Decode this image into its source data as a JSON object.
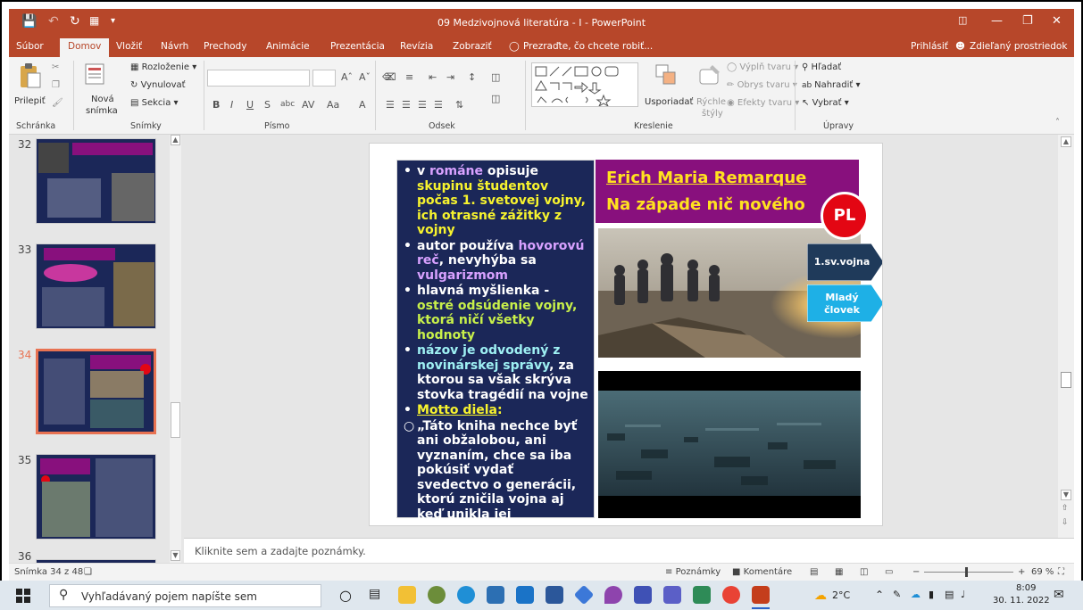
{
  "window": {
    "title": "09 Medzivojnová literatúra - I - PowerPoint",
    "signin": "Prihlásiť",
    "share": "Zdieľaný prostriedok"
  },
  "tabs": [
    "Súbor",
    "Domov",
    "Vložiť",
    "Návrh",
    "Prechody",
    "Animácie",
    "Prezentácia",
    "Revízia",
    "Zobraziť"
  ],
  "active_tab": "Domov",
  "tell_me": "Prezraďte, čo chcete robiť...",
  "ribbon": {
    "paste": "Prilepiť",
    "new_slide_1": "Nová",
    "new_slide_2": "snímka",
    "layout": "Rozloženie",
    "reset": "Vynulovať",
    "section": "Sekcia",
    "arrange": "Usporiadať",
    "quick_styles_1": "Rýchle",
    "quick_styles_2": "štýly",
    "shape_fill": "Výplň tvaru",
    "shape_outline": "Obrys tvaru",
    "shape_effects": "Efekty tvaru",
    "find": "Hľadať",
    "replace": "Nahradiť",
    "select": "Vybrať",
    "group_clipboard": "Schránka",
    "group_slides": "Snímky",
    "group_font": "Písmo",
    "group_paragraph": "Odsek",
    "group_drawing": "Kreslenie",
    "group_editing": "Úpravy"
  },
  "slides_pane": {
    "numbers": [
      "32",
      "33",
      "34",
      "35",
      "36"
    ],
    "selected": "34"
  },
  "slide": {
    "title_line1": "Erich Maria Remarque",
    "title_line2": "Na západe nič nového",
    "badge": "PL",
    "tag1": "1.sv.vojna",
    "tag2_line1": "Mladý",
    "tag2_line2": "človek",
    "bullets": [
      {
        "id": "b1",
        "bullet": "•",
        "segments": [
          {
            "t": "v ",
            "c": "w"
          },
          {
            "t": "románe",
            "c": "p"
          },
          {
            "t": " opisuje ",
            "c": "w"
          },
          {
            "t": "skupinu študentov počas 1. svetovej vojny, ich otrasné zážitky z vojny",
            "c": "y"
          }
        ]
      },
      {
        "id": "b2",
        "bullet": "•",
        "segments": [
          {
            "t": "autor používa ",
            "c": "w"
          },
          {
            "t": "hovorovú reč",
            "c": "p"
          },
          {
            "t": ", nevyhýba sa ",
            "c": "w"
          },
          {
            "t": "vulgarizmom",
            "c": "p"
          }
        ]
      },
      {
        "id": "b3",
        "bullet": "•",
        "segments": [
          {
            "t": "hlavná myšlienka - ",
            "c": "w"
          },
          {
            "t": " ostré odsúdenie vojny, ktorá ničí všetky hodnoty",
            "c": "g"
          }
        ]
      },
      {
        "id": "b4",
        "bullet": "•",
        "segments": [
          {
            "t": "názov je odvodený z novinárskej správy",
            "c": "c"
          },
          {
            "t": ", za ktorou sa však skrýva stovka tragédií na vojne",
            "c": "w"
          }
        ]
      },
      {
        "id": "b5",
        "bullet": "•",
        "segments": [
          {
            "t": "Motto diela",
            "c": "yu"
          },
          {
            "t": ":",
            "c": "y"
          }
        ]
      },
      {
        "id": "b6",
        "bullet": "○",
        "segments": [
          {
            "t": "„Táto kniha nechce byť ani obžalobou, ani vyznaním, chce sa iba pokúsiť vydať svedectvo o generácii, ktorú zničila vojna aj keď unikla jej granátom.“",
            "c": "w"
          }
        ]
      }
    ]
  },
  "notes_placeholder": "Kliknite sem a zadajte poznámky.",
  "status": {
    "slide_count": "Snímka 34 z 48",
    "notes": "Poznámky",
    "comments": "Komentáre",
    "zoom": "69 %"
  },
  "taskbar": {
    "search_placeholder": "Vyhľadávaný pojem napíšte sem",
    "weather": "2°C",
    "time": "8:09",
    "date": "30. 11. 2022"
  },
  "colors": {
    "accent": "#b7472a",
    "slide_text_bg": "#1b2758",
    "title_bg": "#88107d",
    "title_text": "#ffe21f",
    "badge": "#e30613",
    "tag1": "#1f3a5a",
    "tag2": "#1eb0e6"
  }
}
